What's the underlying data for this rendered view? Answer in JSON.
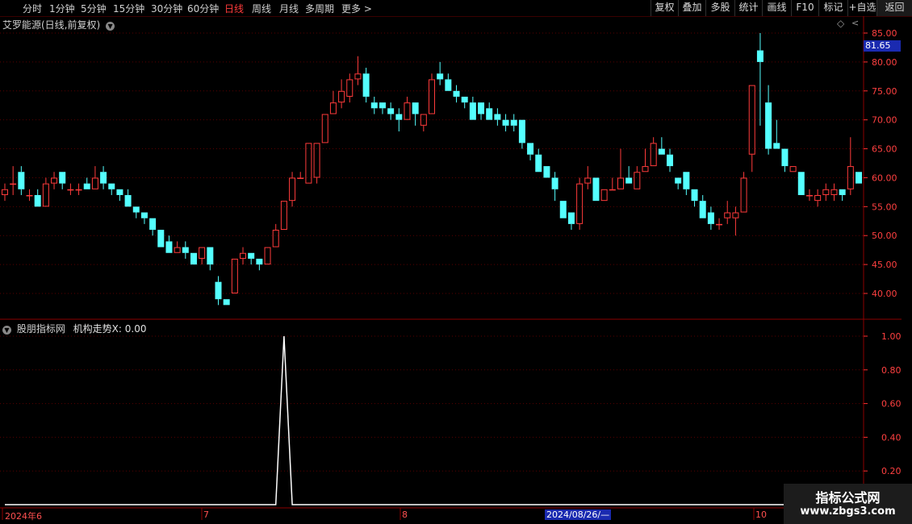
{
  "toolbar": {
    "periods": [
      "分时",
      "1分钟",
      "5分钟",
      "15分钟",
      "30分钟",
      "60分钟",
      "日线",
      "周线",
      "月线",
      "多周期",
      "更多"
    ],
    "active_period": "日线",
    "right_buttons": [
      "复权",
      "叠加",
      "多股",
      "统计",
      "画线",
      "F10",
      "标记",
      "+自选",
      "返回"
    ]
  },
  "main_pane": {
    "title": "艾罗能源(日线,前复权)",
    "price_badge": "81.65",
    "y_ticks": [
      "85.00",
      "80.00",
      "75.00",
      "70.00",
      "65.00",
      "60.00",
      "55.00",
      "50.00",
      "45.00",
      "40.00"
    ]
  },
  "indicator_pane": {
    "title": "股朋指标网",
    "series_label": "机构走势X: 0.00",
    "y_ticks": [
      "1.00",
      "0.80",
      "0.60",
      "0.40",
      "0.20"
    ]
  },
  "x_axis": {
    "labels": [
      "2024年6",
      "7",
      "8",
      "10"
    ],
    "cursor_date": "2024/08/26/—"
  },
  "watermark": {
    "line1": "指标公式网",
    "line2": "www.zbgs3.com"
  },
  "colors": {
    "up": "#ff3b3b",
    "down": "#54ffff",
    "grid": "#5a0000",
    "line": "#ffffff"
  },
  "chart_data": [
    {
      "type": "candlestick",
      "title": "艾罗能源(日线,前复权)",
      "ylim": [
        37.5,
        87
      ],
      "candles": [
        [
          57,
          59,
          58,
          56
        ],
        [
          59,
          62,
          59,
          57
        ],
        [
          61,
          62,
          58,
          57
        ],
        [
          57,
          58,
          57,
          56
        ],
        [
          57,
          58,
          55,
          55
        ],
        [
          55,
          60,
          59,
          55
        ],
        [
          59,
          61,
          60,
          58
        ],
        [
          61,
          61,
          59,
          58
        ],
        [
          58,
          59,
          58,
          57
        ],
        [
          58,
          59,
          58,
          57
        ],
        [
          59,
          60,
          58,
          58
        ],
        [
          58,
          62,
          60,
          58
        ],
        [
          61,
          62,
          59,
          58
        ],
        [
          59,
          59,
          58,
          57
        ],
        [
          58,
          58,
          57,
          56
        ],
        [
          57,
          58,
          55,
          55
        ],
        [
          55,
          55,
          54,
          53
        ],
        [
          54,
          54,
          53,
          52
        ],
        [
          53,
          53,
          51,
          50
        ],
        [
          51,
          51,
          48,
          48
        ],
        [
          49,
          50,
          47,
          47
        ],
        [
          47,
          49,
          48,
          47
        ],
        [
          48,
          49,
          47,
          46
        ],
        [
          47,
          47,
          45,
          45
        ],
        [
          46,
          48,
          48,
          45
        ],
        [
          48,
          48,
          45,
          44
        ],
        [
          42,
          43,
          39,
          38
        ],
        [
          39,
          39,
          38,
          38
        ],
        [
          40,
          46,
          46,
          40
        ],
        [
          46,
          48,
          47,
          45
        ],
        [
          47,
          47,
          46,
          45
        ],
        [
          46,
          46,
          45,
          44
        ],
        [
          45,
          48,
          48,
          45
        ],
        [
          48,
          52,
          51,
          48
        ],
        [
          51,
          56,
          56,
          51
        ],
        [
          56,
          61,
          60,
          55
        ],
        [
          60,
          61,
          60,
          60
        ],
        [
          59,
          66,
          66,
          59
        ],
        [
          60,
          66,
          66,
          59
        ],
        [
          66,
          71,
          71,
          66
        ],
        [
          71,
          75,
          73,
          71
        ],
        [
          73,
          77,
          75,
          72
        ],
        [
          74,
          78,
          77,
          73
        ],
        [
          77,
          81,
          78,
          76
        ],
        [
          78,
          79,
          74,
          73
        ],
        [
          73,
          74,
          72,
          71
        ],
        [
          73,
          73,
          72,
          71
        ],
        [
          72,
          73,
          71,
          70
        ],
        [
          71,
          72,
          70,
          68
        ],
        [
          70,
          74,
          73,
          70
        ],
        [
          73,
          73,
          71,
          69
        ],
        [
          69,
          71,
          71,
          68
        ],
        [
          71,
          78,
          77,
          71
        ],
        [
          78,
          80,
          77,
          76
        ],
        [
          77,
          78,
          75,
          75
        ],
        [
          75,
          76,
          74,
          73
        ],
        [
          74,
          74,
          73,
          72
        ],
        [
          73,
          74,
          70,
          70
        ],
        [
          73,
          73,
          71,
          70
        ],
        [
          72,
          73,
          70,
          70
        ],
        [
          71,
          72,
          70,
          69
        ],
        [
          70,
          71,
          69,
          68
        ],
        [
          70,
          71,
          69,
          68
        ],
        [
          70,
          70,
          66,
          65
        ],
        [
          66,
          66,
          64,
          63
        ],
        [
          64,
          65,
          61,
          61
        ],
        [
          62,
          62,
          60,
          60
        ],
        [
          60,
          61,
          58,
          56
        ],
        [
          56,
          56,
          53,
          53
        ],
        [
          54,
          54,
          52,
          51
        ],
        [
          52,
          60,
          59,
          51
        ],
        [
          59,
          62,
          60,
          58
        ],
        [
          60,
          60,
          56,
          56
        ],
        [
          56,
          58,
          58,
          56
        ],
        [
          58,
          60,
          58,
          58
        ],
        [
          58,
          65,
          60,
          58
        ],
        [
          60,
          62,
          59,
          59
        ],
        [
          58,
          62,
          61,
          58
        ],
        [
          61,
          65,
          62,
          61
        ],
        [
          62,
          67,
          66,
          62
        ],
        [
          65,
          67,
          64,
          64
        ],
        [
          64,
          65,
          62,
          61
        ],
        [
          60,
          60,
          59,
          58
        ],
        [
          61,
          61,
          58,
          57
        ],
        [
          58,
          58,
          56,
          55
        ],
        [
          56,
          57,
          53,
          53
        ],
        [
          54,
          55,
          52,
          51
        ],
        [
          52,
          53,
          52,
          51
        ],
        [
          53,
          56,
          54,
          52
        ],
        [
          53,
          55,
          54,
          50
        ],
        [
          54,
          61,
          60,
          54
        ],
        [
          64,
          76,
          76,
          61
        ],
        [
          82,
          85,
          80,
          69
        ],
        [
          73,
          76,
          65,
          64
        ],
        [
          66,
          70,
          65,
          65
        ],
        [
          65,
          65,
          62,
          61
        ],
        [
          61,
          62,
          62,
          61
        ],
        [
          61,
          61,
          57,
          57
        ],
        [
          57,
          58,
          57,
          56
        ],
        [
          56,
          58,
          57,
          55
        ],
        [
          57,
          59,
          58,
          56
        ],
        [
          57,
          59,
          58,
          56
        ],
        [
          58,
          58,
          57,
          56
        ],
        [
          58,
          67,
          62,
          57
        ],
        [
          61,
          61,
          59,
          59
        ]
      ]
    },
    {
      "type": "line",
      "series": [
        {
          "name": "机构走势X"
        }
      ],
      "ylim": [
        0,
        1.05
      ],
      "values": [
        0,
        0,
        0,
        0,
        0,
        0,
        0,
        0,
        0,
        0,
        0,
        0,
        0,
        0,
        0,
        0,
        0,
        0,
        0,
        0,
        0,
        0,
        0,
        0,
        0,
        0,
        0,
        0,
        0,
        0,
        0,
        0,
        0,
        0,
        1,
        0,
        0,
        0,
        0,
        0,
        0,
        0,
        0,
        0,
        0,
        0,
        0,
        0,
        0,
        0,
        0,
        0,
        0,
        0,
        0,
        0,
        0,
        0,
        0,
        0,
        0,
        0,
        0,
        0,
        0,
        0,
        0,
        0,
        0,
        0,
        0,
        0,
        0,
        0,
        0,
        0,
        0,
        0,
        0,
        0,
        0,
        0,
        0,
        0,
        0,
        0,
        0,
        0,
        0,
        0,
        0,
        0,
        0,
        0,
        0,
        0,
        0,
        0,
        0,
        0,
        0,
        0,
        0,
        0,
        0,
        0,
        0
      ]
    }
  ]
}
